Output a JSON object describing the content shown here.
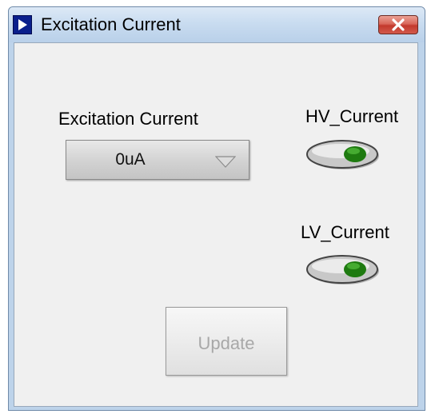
{
  "window": {
    "title": "Excitation Current",
    "close_icon": "close-icon"
  },
  "excitation": {
    "label": "Excitation Current",
    "selected_value": "0uA"
  },
  "hv_current": {
    "label": "HV_Current",
    "state": "off"
  },
  "lv_current": {
    "label": "LV_Current",
    "state": "off"
  },
  "update_button": {
    "label": "Update",
    "enabled": false
  },
  "colors": {
    "led_off": "#1e7a10",
    "title_icon": "#0a1f8c",
    "close_button": "#c3392d"
  }
}
